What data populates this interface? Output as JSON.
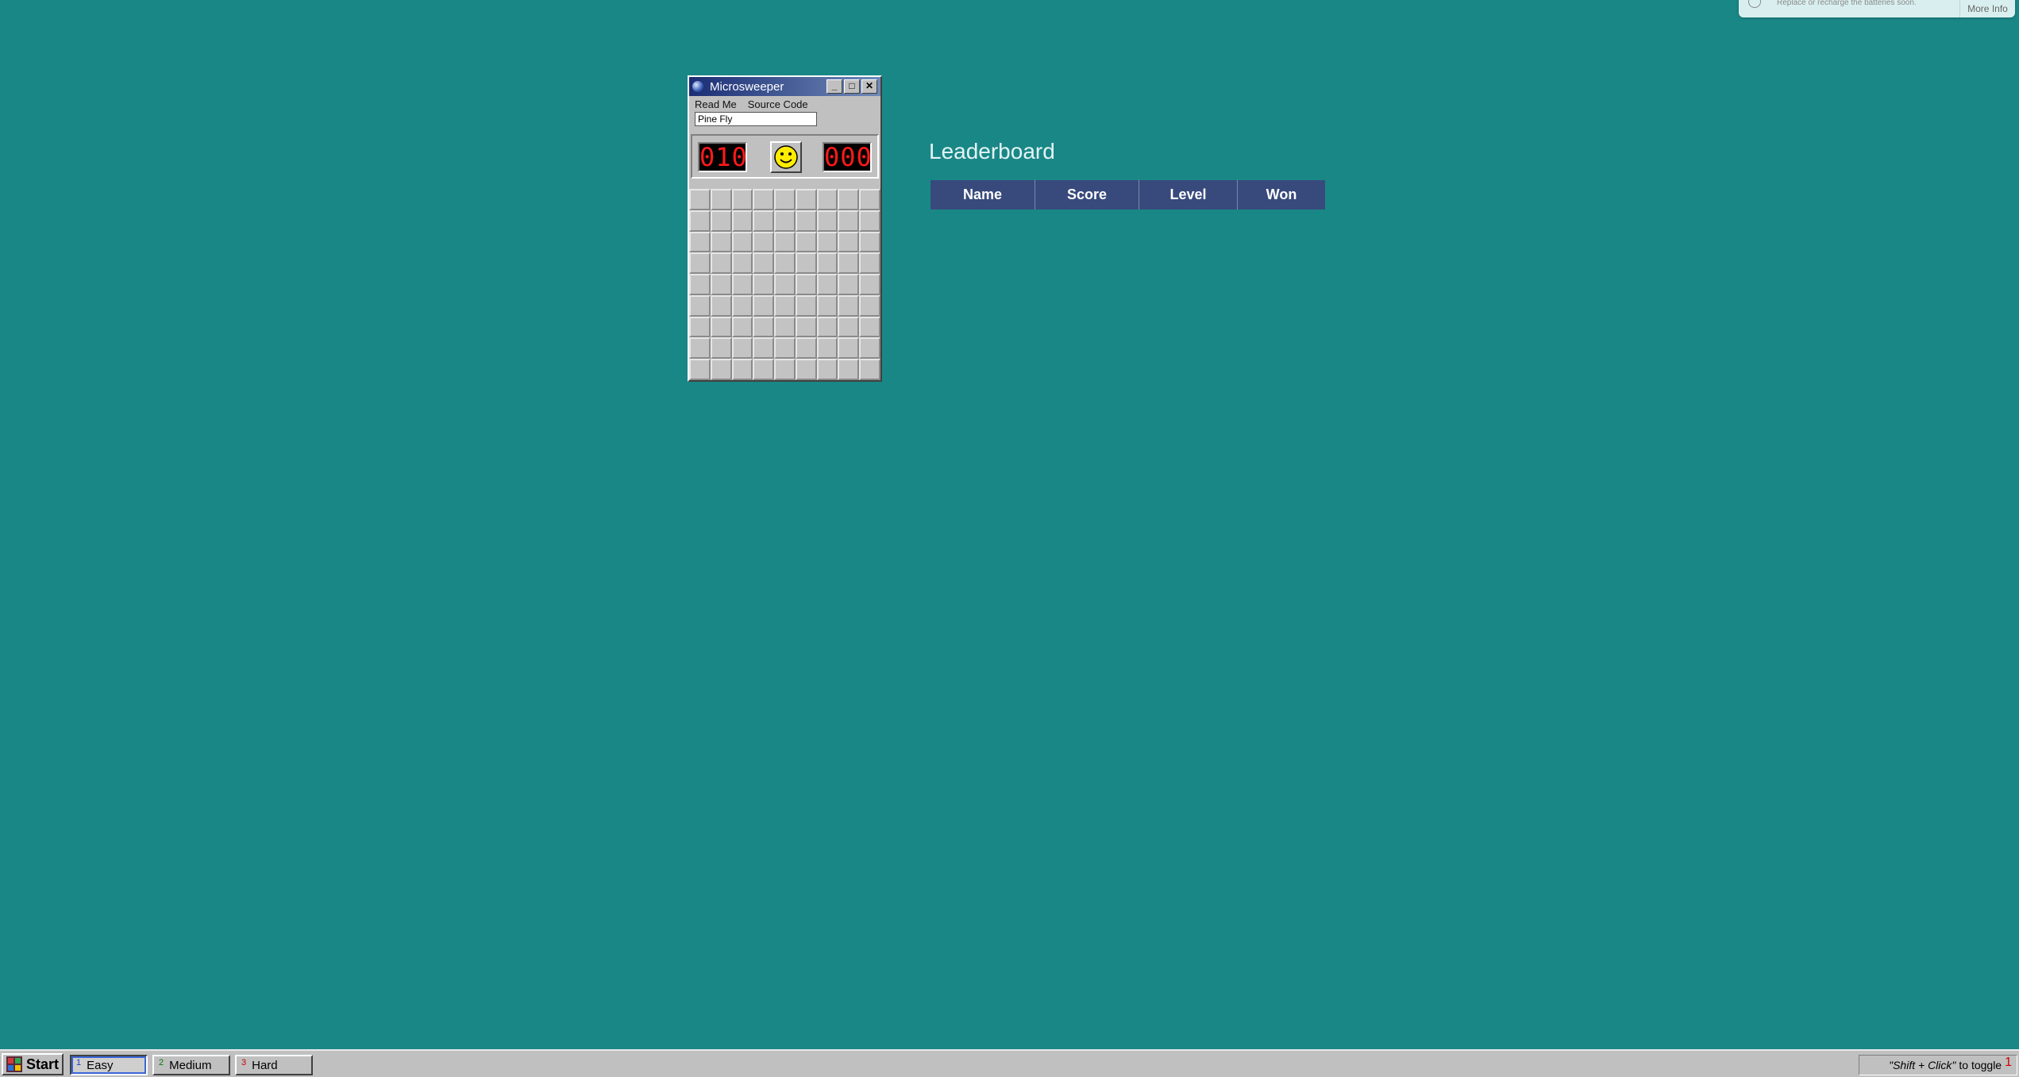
{
  "notification": {
    "text": "Replace or recharge the batteries soon.",
    "more_label": "More Info"
  },
  "window": {
    "title": "Microsweeper",
    "buttons": {
      "minimize": "_",
      "maximize": "□",
      "close": "✕"
    },
    "menu": [
      "Read Me",
      "Source Code"
    ],
    "player_name": "Pine Fly",
    "mine_counter": "010",
    "timer": "000",
    "face": "smiley-face-icon",
    "grid": {
      "rows": 9,
      "cols": 9
    }
  },
  "leaderboard": {
    "title": "Leaderboard",
    "columns": [
      "Name",
      "Score",
      "Level",
      "Won"
    ],
    "rows": []
  },
  "taskbar": {
    "start_label": "Start",
    "tasks": [
      {
        "num": "1",
        "label": "Easy",
        "active": true,
        "num_color": "#1a3fb8"
      },
      {
        "num": "2",
        "label": "Medium",
        "active": false,
        "num_color": "#0a7a0a"
      },
      {
        "num": "3",
        "label": "Hard",
        "active": false,
        "num_color": "#cc0000"
      }
    ],
    "tray": {
      "hint_italic": "\"Shift + Click\"",
      "hint_rest": "to toggle",
      "num": "1"
    }
  },
  "colors": {
    "desktop": "#1a8787",
    "title_gradient_start": "#1b2d74",
    "table_header": "#384a7c",
    "counter_digits": "#ff1a1a"
  }
}
